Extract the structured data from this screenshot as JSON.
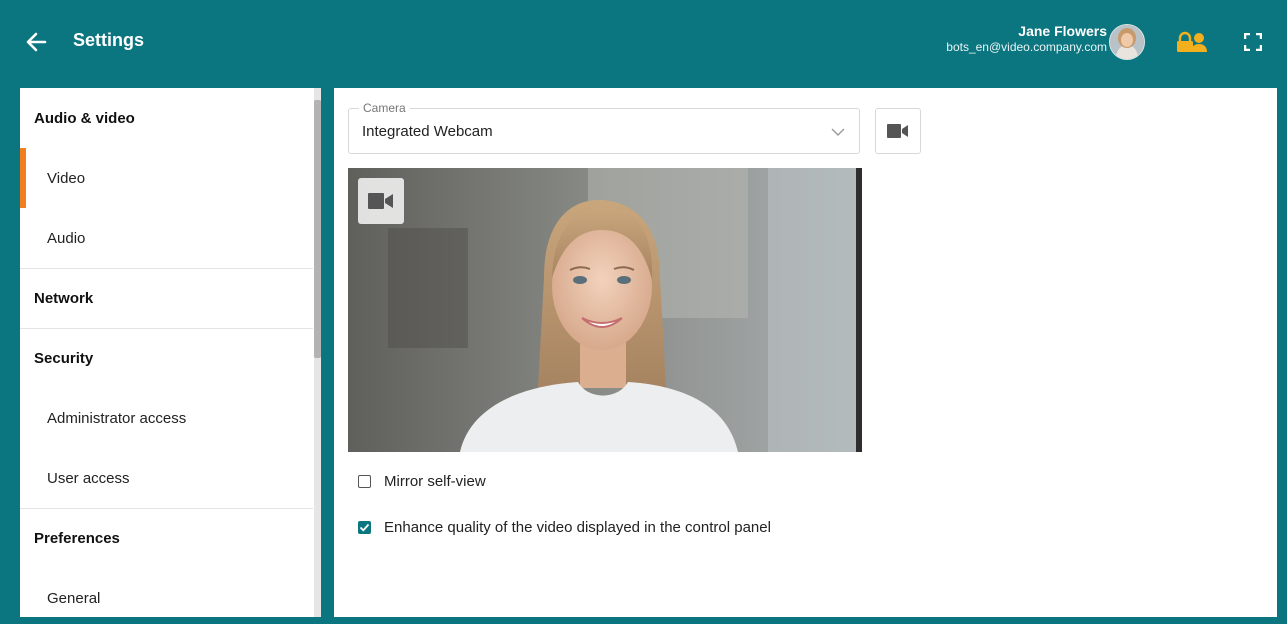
{
  "header": {
    "title": "Settings",
    "user_name": "Jane Flowers",
    "user_email": "bots_en@video.company.com"
  },
  "sidebar": {
    "items": [
      {
        "label": "Audio & video",
        "kind": "section"
      },
      {
        "label": "Video",
        "kind": "sub",
        "active": true
      },
      {
        "label": "Audio",
        "kind": "sub"
      },
      {
        "label": "Network",
        "kind": "section"
      },
      {
        "label": "Security",
        "kind": "section"
      },
      {
        "label": "Administrator access",
        "kind": "sub"
      },
      {
        "label": "User access",
        "kind": "sub"
      },
      {
        "label": "Preferences",
        "kind": "section"
      },
      {
        "label": "General",
        "kind": "sub"
      }
    ]
  },
  "main": {
    "camera_label": "Camera",
    "camera_value": "Integrated Webcam",
    "options": [
      {
        "label": "Mirror self-view",
        "checked": false
      },
      {
        "label": "Enhance quality of the video displayed in the control panel",
        "checked": true
      }
    ]
  },
  "colors": {
    "header_bg": "#0c7680",
    "accent": "#f07f1f",
    "icon_gold": "#f2b01e",
    "checkbox_checked": "#0c7680"
  },
  "icons": {
    "back": "arrow-left-icon",
    "lock_user": "lock-user-icon",
    "fullscreen": "fullscreen-icon",
    "chevron": "chevron-down-icon",
    "camera": "video-camera-icon"
  }
}
